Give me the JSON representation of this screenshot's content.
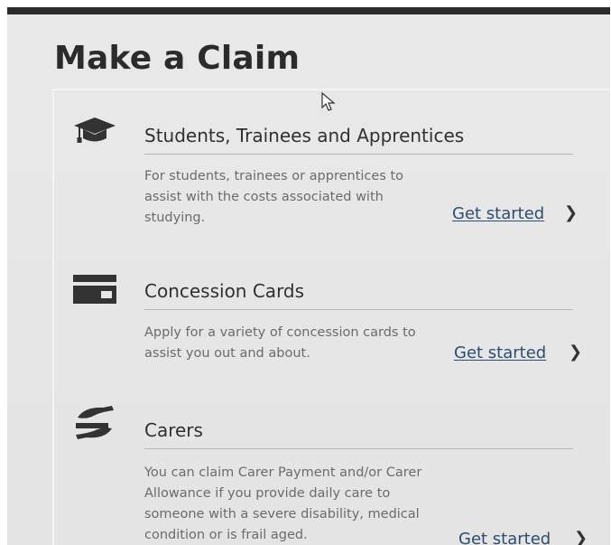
{
  "page": {
    "title": "Make a Claim"
  },
  "claims": [
    {
      "icon": "graduation-cap-icon",
      "title": "Students, Trainees and Apprentices",
      "description": "For students, trainees or apprentices to assist with the costs associated with studying.",
      "link_label": "Get started"
    },
    {
      "icon": "card-icon",
      "title": "Concession Cards",
      "description": "Apply for a variety of concession cards to assist you out and about.",
      "link_label": "Get started"
    },
    {
      "icon": "caring-hands-icon",
      "title": "Carers",
      "description": "You can claim Carer Payment and/or Carer Allowance if you provide daily care to someone with a severe disability, medical condition or is frail aged.",
      "link_label": "Get started"
    }
  ],
  "colors": {
    "background": "#e6e6e6",
    "link": "#2c4c72",
    "heading": "#2b2b2b",
    "icon": "#333333"
  }
}
